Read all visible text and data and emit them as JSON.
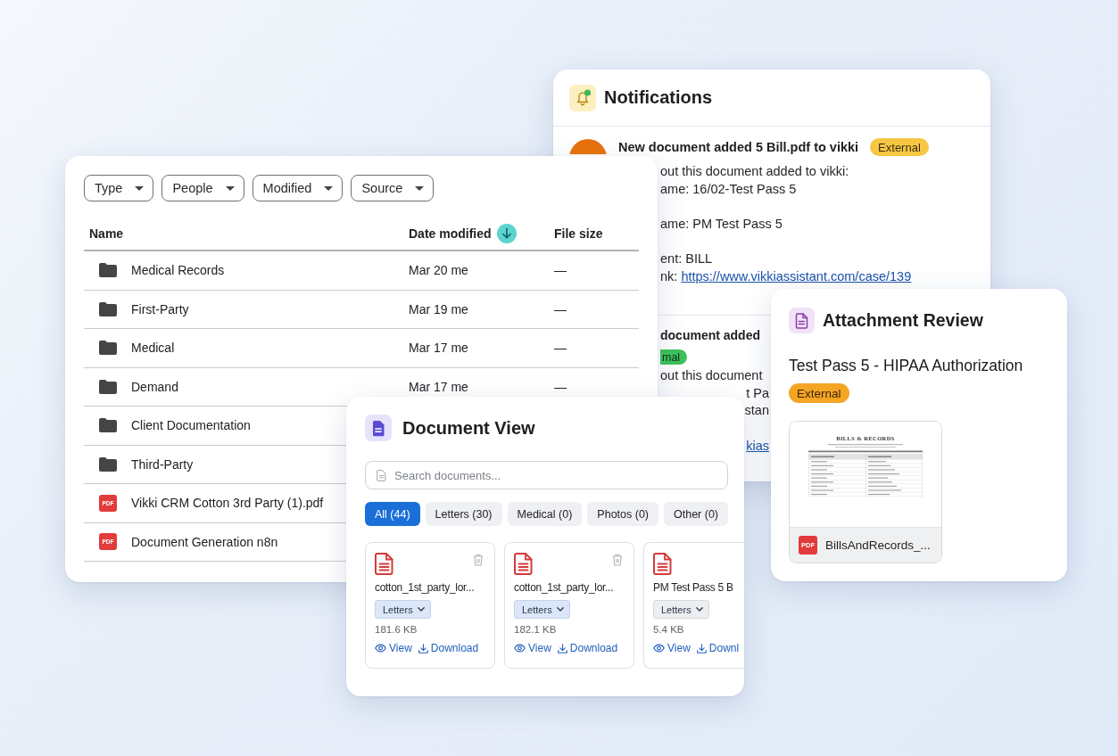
{
  "notifications": {
    "title": "Notifications",
    "items": [
      {
        "title": "New document added 5 Bill.pdf to vikki",
        "badge": {
          "label": "External",
          "color": "#f7c744"
        },
        "paragraphs": [
          [
            {
              "text": "out this document added to vikki:"
            },
            {
              "text": "ame: 16/02-Test Pass 5"
            }
          ],
          [
            {
              "text": "ame: PM Test Pass 5"
            }
          ],
          [
            {
              "text": "ent: BILL"
            },
            {
              "text": "nk:",
              "link": "https://www.vikkiassistant.com/case/139"
            }
          ]
        ]
      },
      {
        "title": "document added",
        "badge": {
          "label": "mal",
          "color": "#3ec25b"
        },
        "paragraphs": [
          [
            {
              "text": "out this document"
            },
            {
              "text": "t Pa"
            },
            {
              "text": "stan"
            }
          ],
          [
            {
              "link": "kias"
            }
          ]
        ]
      }
    ]
  },
  "files": {
    "filters": [
      {
        "label": "Type"
      },
      {
        "label": "People"
      },
      {
        "label": "Modified"
      },
      {
        "label": "Source"
      }
    ],
    "columns": [
      {
        "label": "Name",
        "sorted": false
      },
      {
        "label": "Date modified",
        "sorted": true
      },
      {
        "label": "File size",
        "sorted": false
      }
    ],
    "rows": [
      {
        "kind": "folder",
        "name": "Medical Records",
        "date": "Mar 20 me",
        "size": "—"
      },
      {
        "kind": "folder",
        "name": "First-Party",
        "date": "Mar 19 me",
        "size": "—"
      },
      {
        "kind": "folder",
        "name": "Medical",
        "date": "Mar 17 me",
        "size": "—"
      },
      {
        "kind": "folder",
        "name": "Demand",
        "date": "Mar 17 me",
        "size": "—"
      },
      {
        "kind": "folder",
        "name": "Client Documentation"
      },
      {
        "kind": "folder",
        "name": "Third-Party"
      },
      {
        "kind": "pdf",
        "icon_text": "PDF",
        "name": "Vikki CRM Cotton 3rd Party (1).pdf"
      },
      {
        "kind": "pdf",
        "icon_text": "PDF",
        "name": "Document Generation n8n"
      }
    ]
  },
  "document_view": {
    "title": "Document View",
    "search": {
      "placeholder": "Search documents..."
    },
    "filters": [
      {
        "label": "All (44)",
        "selected": true
      },
      {
        "label": "Letters (30)",
        "selected": false
      },
      {
        "label": "Medical (0)",
        "selected": false
      },
      {
        "label": "Photos (0)",
        "selected": false
      },
      {
        "label": "Other (0)",
        "selected": false
      }
    ],
    "documents": [
      {
        "name": "cotton_1st_party_lor...",
        "category": "Letters",
        "size": "181.6 KB",
        "cut": false,
        "actions": [
          {
            "kind": "view",
            "label": "View"
          },
          {
            "kind": "download",
            "label": "Download"
          }
        ]
      },
      {
        "name": "cotton_1st_party_lor...",
        "category": "Letters",
        "size": "182.1 KB",
        "cut": false,
        "actions": [
          {
            "kind": "view",
            "label": "View"
          },
          {
            "kind": "download",
            "label": "Download"
          }
        ]
      },
      {
        "name": "PM Test Pass 5 B",
        "category": "Letters",
        "size": "5.4 KB",
        "cut": true,
        "actions": [
          {
            "kind": "view",
            "label": "View"
          },
          {
            "kind": "download",
            "label": "Downl"
          }
        ]
      }
    ]
  },
  "attachment_review": {
    "title": "Attachment Review",
    "subject": "Test Pass 5 - HIPAA Authorization",
    "badge": {
      "label": "External",
      "color": "#f5a524"
    },
    "attachment": {
      "preview_heading": "BILLS & RECORDS",
      "file_tag": "PDF",
      "name": "BillsAndRecords_..."
    }
  }
}
